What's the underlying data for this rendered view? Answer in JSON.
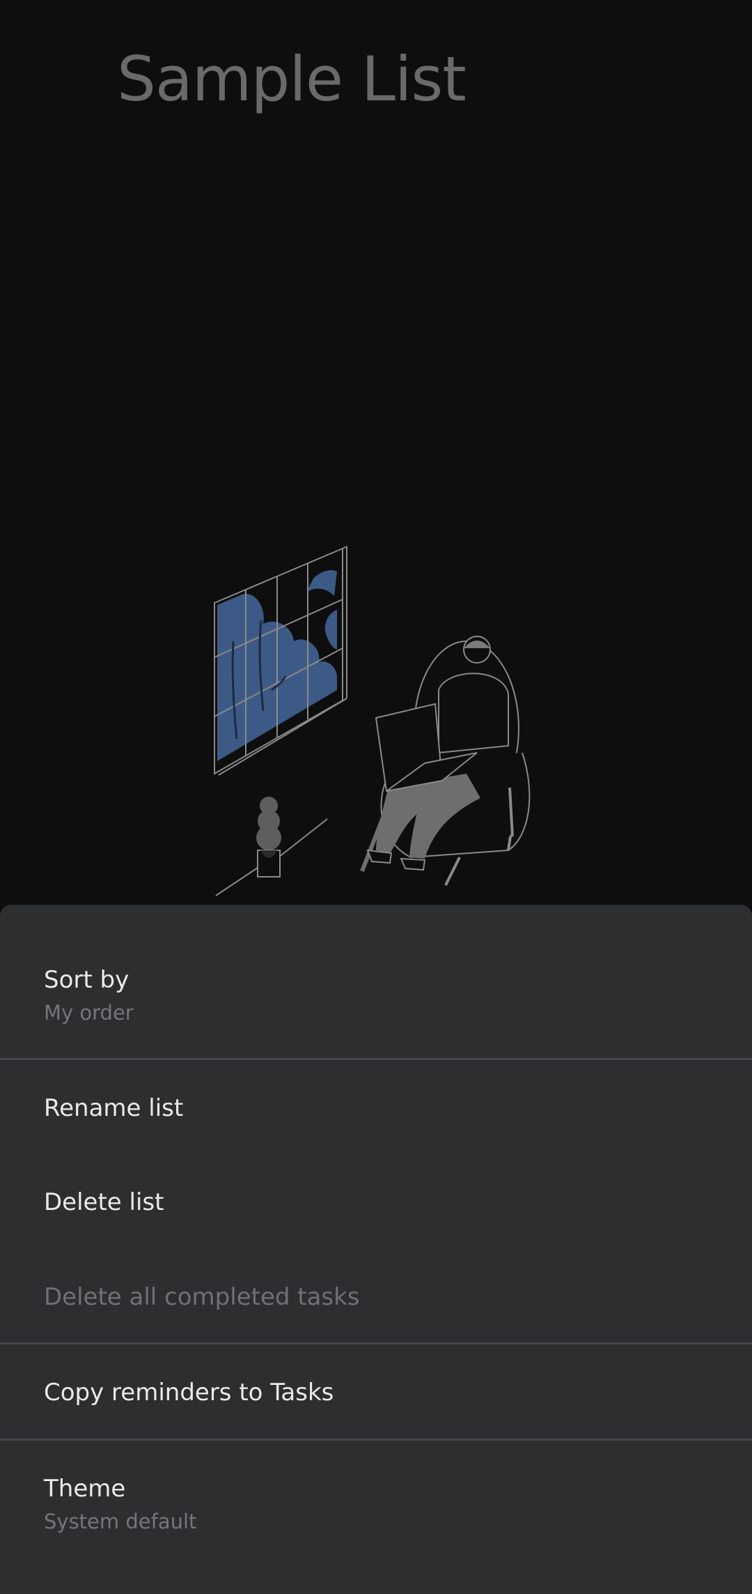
{
  "page": {
    "title": "Sample List"
  },
  "illustration": {
    "icon": "empty-list-illustration-person-on-laptop-by-window",
    "colors": {
      "window_foliage": "#3d5a87",
      "lines": "#8a8a8a",
      "figure_fill": "#6e6e6e"
    }
  },
  "menu": {
    "sort_by": {
      "label": "Sort by",
      "value": "My order"
    },
    "rename": {
      "label": "Rename list"
    },
    "delete": {
      "label": "Delete list"
    },
    "delete_completed": {
      "label": "Delete all completed tasks",
      "enabled": false
    },
    "copy_reminders": {
      "label": "Copy reminders to Tasks"
    },
    "theme": {
      "label": "Theme",
      "value": "System default"
    }
  },
  "colors": {
    "background": "#0e0e0e",
    "sheet": "#2d2e30",
    "text_primary": "#e9eaec",
    "text_secondary": "#74767a",
    "divider": "#46484b"
  }
}
